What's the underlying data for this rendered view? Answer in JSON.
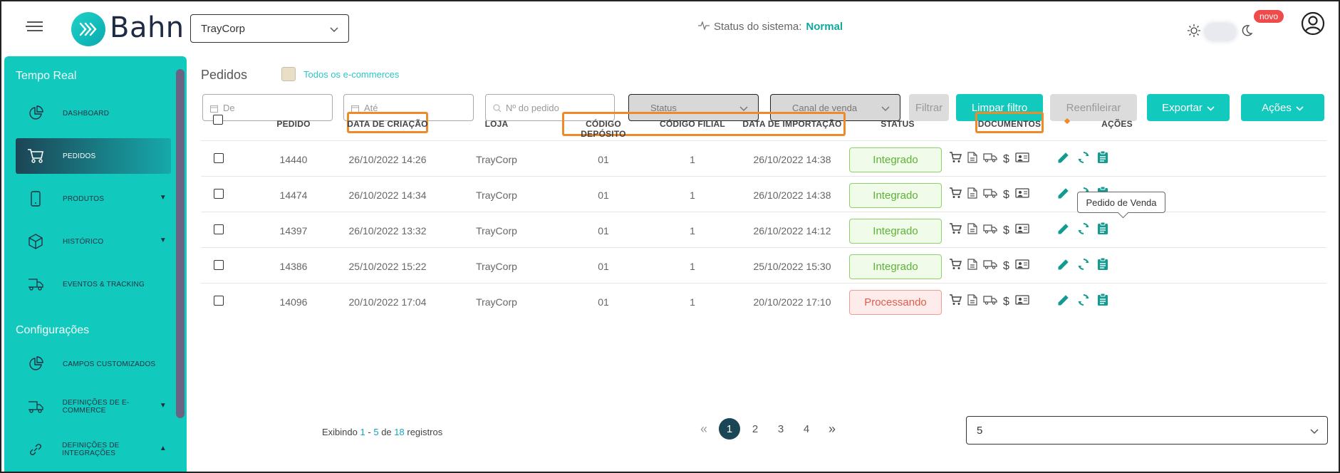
{
  "header": {
    "logo_text": "Bahn",
    "store_selected": "TrayCorp",
    "status_label": "Status do sistema:",
    "status_value": "Normal",
    "novo_badge": "novo"
  },
  "sidebar": {
    "section_realtime": "Tempo Real",
    "section_config": "Configurações",
    "items": [
      {
        "label": "DASHBOARD"
      },
      {
        "label": "PEDIDOS"
      },
      {
        "label": "PRODUTOS"
      },
      {
        "label": "HISTÓRICO"
      },
      {
        "label": "EVENTOS & TRACKING"
      },
      {
        "label": "CAMPOS CUSTOMIZADOS"
      },
      {
        "label": "DEFINIÇÕES DE E-COMMERCE"
      },
      {
        "label": "DEFINIÇÕES DE INTEGRAÇÕES"
      }
    ]
  },
  "main": {
    "title": "Pedidos",
    "all_ecommerces": "Todos os e-commerces",
    "filters": {
      "from_placeholder": "De",
      "to_placeholder": "Até",
      "order_placeholder": "Nº do pedido",
      "status_placeholder": "Status",
      "channel_placeholder": "Canal de venda",
      "filter_btn": "Filtrar",
      "clear_btn": "Limpar filtro",
      "requeue_btn": "Reenfileirar",
      "export_btn": "Exportar",
      "actions_btn": "Ações"
    },
    "columns": {
      "pedido": "PEDIDO",
      "data_criacao": "DATA DE CRIAÇÃO",
      "loja": "LOJA",
      "cod_deposito": "CÓDIGO DEPÓSITO",
      "cod_filial": "CÓDIGO FILIAL",
      "data_importacao": "DATA DE IMPORTAÇÃO",
      "status": "STATUS",
      "documentos": "DOCUMENTOS",
      "acoes": "AÇÕES"
    },
    "rows": [
      {
        "pedido": "14440",
        "criacao": "26/10/2022 14:26",
        "loja": "TrayCorp",
        "deposito": "01",
        "filial": "1",
        "importacao": "26/10/2022 14:38",
        "status": "Integrado"
      },
      {
        "pedido": "14474",
        "criacao": "26/10/2022 14:34",
        "loja": "TrayCorp",
        "deposito": "01",
        "filial": "1",
        "importacao": "26/10/2022 14:38",
        "status": "Integrado"
      },
      {
        "pedido": "14397",
        "criacao": "26/10/2022 13:32",
        "loja": "TrayCorp",
        "deposito": "01",
        "filial": "1",
        "importacao": "26/10/2022 14:12",
        "status": "Integrado"
      },
      {
        "pedido": "14386",
        "criacao": "25/10/2022 15:22",
        "loja": "TrayCorp",
        "deposito": "01",
        "filial": "1",
        "importacao": "25/10/2022 15:30",
        "status": "Integrado"
      },
      {
        "pedido": "14096",
        "criacao": "20/10/2022 17:04",
        "loja": "TrayCorp",
        "deposito": "01",
        "filial": "1",
        "importacao": "20/10/2022 17:10",
        "status": "Processando"
      }
    ],
    "tooltip": "Pedido de Venda",
    "pager": {
      "prefix": "Exibindo",
      "from": "1",
      "dash": "-",
      "to": "5",
      "of": "de",
      "total": "18",
      "suffix": "registros",
      "pages": [
        "1",
        "2",
        "3",
        "4"
      ],
      "per_page": "5"
    }
  },
  "colors": {
    "teal": "#12c9bd",
    "highlight": "#ee8a2a",
    "integrated": "#5cb337",
    "processing": "#e25b4c"
  }
}
